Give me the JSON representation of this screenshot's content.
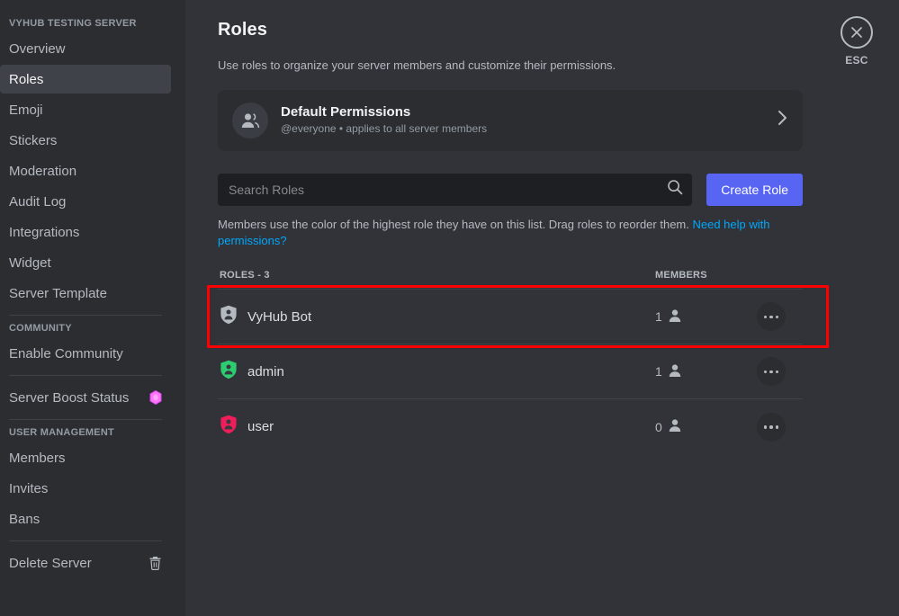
{
  "sidebar": {
    "server_name": "VYHUB TESTING SERVER",
    "server_items": [
      {
        "label": "Overview"
      },
      {
        "label": "Roles"
      },
      {
        "label": "Emoji"
      },
      {
        "label": "Stickers"
      },
      {
        "label": "Moderation"
      },
      {
        "label": "Audit Log"
      },
      {
        "label": "Integrations"
      },
      {
        "label": "Widget"
      },
      {
        "label": "Server Template"
      }
    ],
    "community_header": "COMMUNITY",
    "community_items": [
      {
        "label": "Enable Community"
      }
    ],
    "boost_item": {
      "label": "Server Boost Status",
      "icon": "boost-gem-icon",
      "color": "#ff73fa"
    },
    "user_management_header": "USER MANAGEMENT",
    "user_management_items": [
      {
        "label": "Members"
      },
      {
        "label": "Invites"
      },
      {
        "label": "Bans"
      }
    ],
    "delete_item": {
      "label": "Delete Server",
      "icon": "trash-icon"
    }
  },
  "esc": {
    "label": "ESC",
    "icon": "close-icon"
  },
  "main": {
    "title": "Roles",
    "subtitle": "Use roles to organize your server members and customize their permissions.",
    "default_permissions": {
      "title": "Default Permissions",
      "subtitle": "@everyone • applies to all server members",
      "avatar_icon": "people-icon",
      "chevron_icon": "chevron-right-icon"
    },
    "search": {
      "placeholder": "Search Roles",
      "value": "",
      "icon": "search-icon"
    },
    "create_role_label": "Create Role",
    "create_role_color": "#5865f2",
    "hint_text": "Members use the color of the highest role they have on this list. Drag roles to reorder them. ",
    "hint_link": "Need help with permissions?",
    "hint_link_color": "#00a8fc",
    "table": {
      "col_roles": "ROLES - 3",
      "col_members": "MEMBERS",
      "rows": [
        {
          "name": "VyHub Bot",
          "members": "1",
          "color": "#b5bac1",
          "icon": "role-shield-icon",
          "member_icon": "person-icon",
          "actions_icon": "more-options-icon",
          "highlighted": true
        },
        {
          "name": "admin",
          "members": "1",
          "color": "#2ecc71",
          "icon": "role-shield-icon",
          "member_icon": "person-icon",
          "actions_icon": "more-options-icon",
          "highlighted": false
        },
        {
          "name": "user",
          "members": "0",
          "color": "#ed1e5a",
          "icon": "role-shield-icon",
          "member_icon": "person-icon",
          "actions_icon": "more-options-icon",
          "highlighted": false
        }
      ]
    }
  }
}
